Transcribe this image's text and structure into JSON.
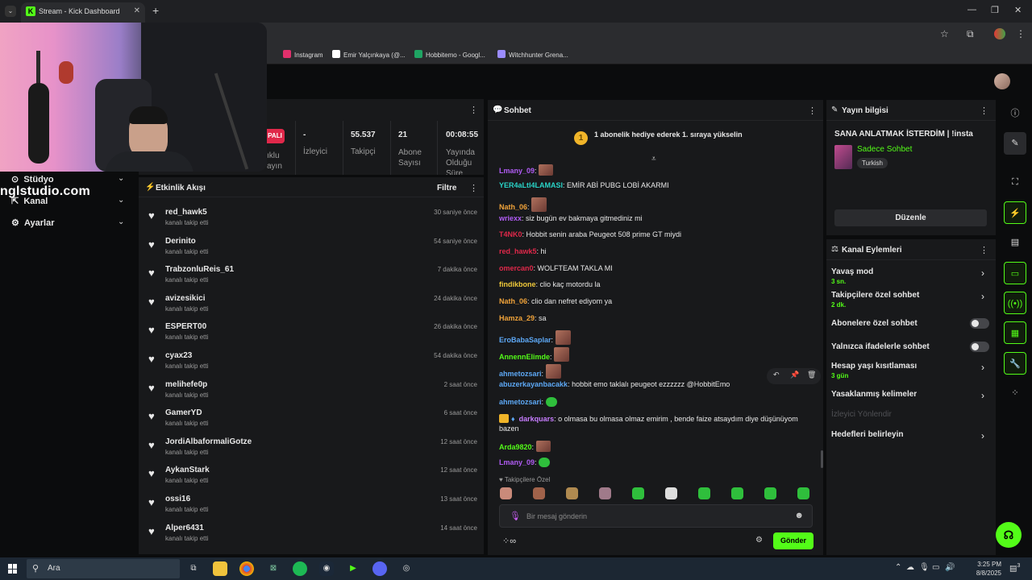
{
  "browser": {
    "tab_title": "Stream - Kick Dashboard",
    "tab_favicon_letter": "K",
    "bookmarks": [
      {
        "label": "Instagram",
        "color": "#e1306c"
      },
      {
        "label": "Emir Yalçınkaya (@...",
        "color": "#ffffff"
      },
      {
        "label": "Hobbitemo - Googl...",
        "color": "#1fa463"
      },
      {
        "label": "Witchhunter Grena...",
        "color": "#9b8cff"
      }
    ]
  },
  "nav": {
    "items": [
      {
        "label": "Stüdyo"
      },
      {
        "label": "Kanal"
      },
      {
        "label": "Ayarlar"
      }
    ],
    "overlay_text": "nglstudio.com"
  },
  "stats": {
    "live_badge": "PALI",
    "partial_label": "ıklu\nayın",
    "items": [
      {
        "value": "-",
        "label": "İzleyici"
      },
      {
        "value": "55.537",
        "label": "Takipçi"
      },
      {
        "value": "21",
        "label": "Abone\nSayısı"
      },
      {
        "value": "00:08:55",
        "label": "Yayında\nOlduğu\nSüre"
      }
    ]
  },
  "feed": {
    "title": "Etkinlik Akışı",
    "filter_label": "Filtre",
    "rows": [
      {
        "user": "red_hawk5",
        "action": "kanalı takip etti",
        "time": "30 saniye önce"
      },
      {
        "user": "Derinito",
        "action": "kanalı takip etti",
        "time": "54 saniye önce"
      },
      {
        "user": "TrabzonluReis_61",
        "action": "kanalı takip etti",
        "time": "7 dakika önce"
      },
      {
        "user": "avizesikici",
        "action": "kanalı takip etti",
        "time": "24 dakika önce"
      },
      {
        "user": "ESPERT00",
        "action": "kanalı takip etti",
        "time": "26 dakika önce"
      },
      {
        "user": "cyax23",
        "action": "kanalı takip etti",
        "time": "54 dakika önce"
      },
      {
        "user": "melihefe0p",
        "action": "kanalı takip etti",
        "time": "2 saat önce"
      },
      {
        "user": "GamerYD",
        "action": "kanalı takip etti",
        "time": "6 saat önce"
      },
      {
        "user": "JordiAlbaformaliGotze",
        "action": "kanalı takip etti",
        "time": "12 saat önce"
      },
      {
        "user": "AykanStark",
        "action": "kanalı takip etti",
        "time": "12 saat önce"
      },
      {
        "user": "ossi16",
        "action": "kanalı takip etti",
        "time": "13 saat önce"
      },
      {
        "user": "Alper6431",
        "action": "kanalı takip etti",
        "time": "14 saat önce"
      }
    ]
  },
  "chat": {
    "title": "Sohbet",
    "banner": "1 abonelik hediye ederek 1. sıraya yükselin",
    "banner_coin": "1",
    "messages": [
      {
        "user": "Lmany_09",
        "color": "#b15cf5",
        "text": "",
        "emote": "img"
      },
      {
        "user": "YER4aLtI4LAMASI",
        "color": "#29d3c7",
        "text": "EMİR ABİ PUBG LOBİ AKARMI",
        "emote": ""
      },
      {
        "user": "Nath_06",
        "color": "#f0a33a",
        "text": "",
        "emote": "img-big"
      },
      {
        "user": "wriexx",
        "color": "#b15cf5",
        "text": "siz bugün ev bakmaya gitmediniz mi",
        "emote": ""
      },
      {
        "user": "T4NK0",
        "color": "#e0284a",
        "text": "Hobbit senin araba Peugeot 508 prime GT miydi",
        "emote": ""
      },
      {
        "user": "red_hawk5",
        "color": "#e0284a",
        "text": "hi",
        "emote": ""
      },
      {
        "user": "omercan0",
        "color": "#e0284a",
        "text": "WOLFTEAM TAKLA MI",
        "emote": ""
      },
      {
        "user": "findikbone",
        "color": "#f0c93a",
        "text": "clio kaç motordu la",
        "emote": ""
      },
      {
        "user": "Nath_06",
        "color": "#f0a33a",
        "text": "clio dan nefret ediyom ya",
        "emote": ""
      },
      {
        "user": "Hamza_29",
        "color": "#f0a33a",
        "text": "sa",
        "emote": ""
      },
      {
        "user": "EroBabaSaplar",
        "color": "#5da8f5",
        "text": "",
        "emote": "img-big"
      },
      {
        "user": "AnnennElimde",
        "color": "#53fc18",
        "text": "",
        "emote": "img-big"
      },
      {
        "user": "ahmetozsari",
        "color": "#5da8f5",
        "text": "",
        "emote": "img-big"
      },
      {
        "user": "abuzerkayanbacakk",
        "color": "#5da8f5",
        "text": "hobbit emo taklalı peugeot ezzzzzz @HobbitEmo",
        "emote": ""
      },
      {
        "user": "ahmetozsari",
        "color": "#5da8f5",
        "text": "",
        "emote": "green"
      },
      {
        "user": "darkquars",
        "color": "#c77dff",
        "text": "o olmasa bu olmasa olmaz emirim , bende faize atsaydım diye düşünüyom",
        "emote": ""
      },
      {
        "user": "",
        "color": "#e8e8e8",
        "text": "bazen",
        "emote": ""
      },
      {
        "user": "Arda9820",
        "color": "#53fc18",
        "text": "",
        "emote": "img"
      },
      {
        "user": "Lmany_09",
        "color": "#b15cf5",
        "text": "",
        "emote": "green"
      }
    ],
    "emote_bar_label": "♥ Takipçilere Özel",
    "input_placeholder": "Bir mesaj gönderin",
    "send_label": "Gönder"
  },
  "stream_info": {
    "title": "Yayın bilgisi",
    "stream_title": "SANA ANLATMAK İSTERDİM | !insta",
    "category": "Sadece Sohbet",
    "language": "Turkish",
    "edit_label": "Düzenle"
  },
  "channel_actions": {
    "title": "Kanal Eylemleri",
    "items": [
      {
        "label": "Yavaş mod",
        "sub": "3 sn.",
        "control": "chevron"
      },
      {
        "label": "Takipçilere özel sohbet",
        "sub": "2 dk.",
        "control": "chevron"
      },
      {
        "label": "Abonelere özel sohbet",
        "sub": "",
        "control": "toggle",
        "on": false
      },
      {
        "label": "Yalnızca ifadelerle sohbet",
        "sub": "",
        "control": "toggle",
        "on": false
      },
      {
        "label": "Hesap yaşı kısıtlaması",
        "sub": "3 gün",
        "control": "chevron"
      },
      {
        "label": "Yasaklanmış kelimeler",
        "sub": "",
        "control": "chevron"
      },
      {
        "label": "İzleyici Yönlendir",
        "sub": "",
        "control": "none",
        "disabled": true
      },
      {
        "label": "Hedefleri belirleyin",
        "sub": "",
        "control": "chevron"
      }
    ]
  },
  "taskbar": {
    "search_placeholder": "Ara",
    "time": "3:25 PM",
    "date": "8/8/2025",
    "notification_count": "3"
  },
  "colors": {
    "accent": "#53fc18",
    "panel": "#18191b",
    "live": "#e0284a"
  }
}
